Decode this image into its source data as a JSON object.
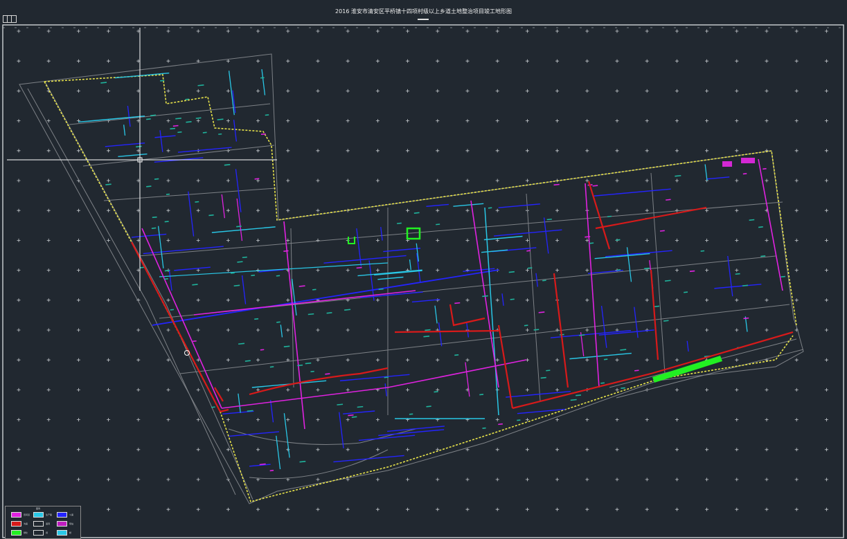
{
  "title": "2016 淮安市清安区平桥镇十四项村级以上乡道土地整治项目竣工地形图",
  "colors": {
    "background": "#212830",
    "road_outline": "#7d8186",
    "boundary": "#e8e34a",
    "ditch_blue": "#2424ff",
    "ditch_cyan": "#29c7e6",
    "road_magenta": "#e022e0",
    "main_red": "#d81a1a",
    "green_area": "#22f022",
    "label_teal": "#1fb39c",
    "grid_cross": "#c8ccd0"
  },
  "legend": {
    "header": "图例",
    "items": [
      {
        "label": "田间道",
        "color": "#e022e0"
      },
      {
        "label": "生产路",
        "color": "#29c7e6"
      },
      {
        "label": "斗渠",
        "color": "#2424ff"
      },
      {
        "label": "沟渠",
        "color": "#d81a1a"
      },
      {
        "label": "涵洞",
        "color": "#dddddd"
      },
      {
        "label": "泵站",
        "color": "#c01ec0"
      },
      {
        "label": "绿化",
        "color": "#22f022"
      },
      {
        "label": "闸",
        "color": "#bbbbbb"
      },
      {
        "label": "桥",
        "color": "#29c7e6"
      }
    ]
  },
  "icons": [
    "viewport-menu-icon",
    "crosshair-cursor-icon",
    "snap-marker-icon"
  ]
}
